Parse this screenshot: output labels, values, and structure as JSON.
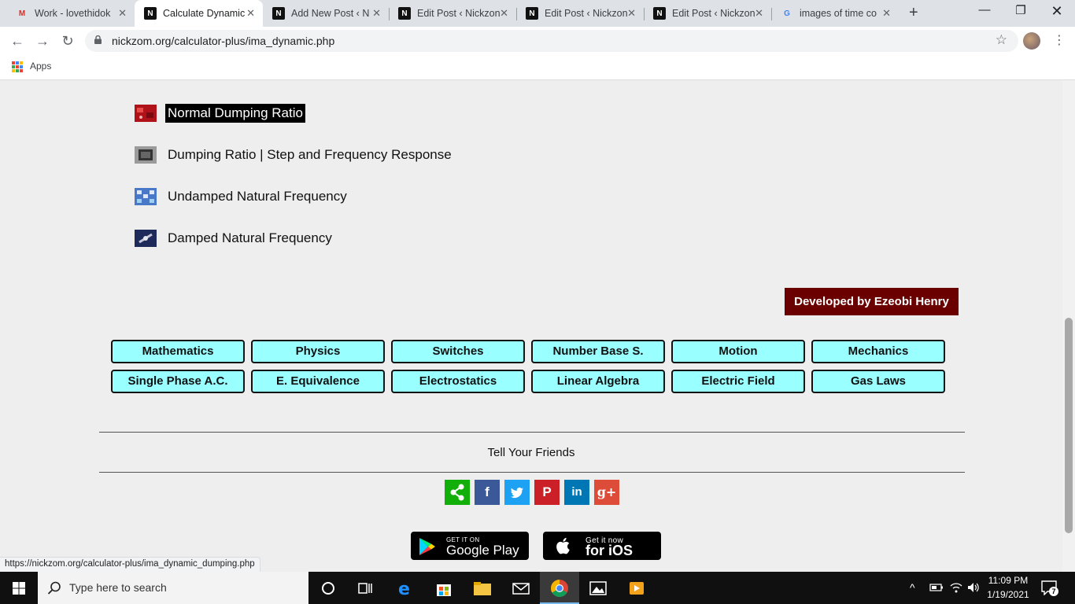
{
  "browser": {
    "tabs": [
      {
        "title": "Work - lovethidok",
        "favicon": "gmail-icon"
      },
      {
        "title": "Calculate Dynamic",
        "favicon": "nickzom-icon"
      },
      {
        "title": "Add New Post ‹ N",
        "favicon": "nickzom-icon"
      },
      {
        "title": "Edit Post ‹ Nickzon",
        "favicon": "nickzom-icon"
      },
      {
        "title": "Edit Post ‹ Nickzon",
        "favicon": "nickzom-icon"
      },
      {
        "title": "Edit Post ‹ Nickzon",
        "favicon": "nickzom-icon"
      },
      {
        "title": "images of time co",
        "favicon": "google-icon"
      }
    ],
    "url": "nickzom.org/calculator-plus/ima_dynamic.php",
    "bookmarks": {
      "apps_label": "Apps"
    },
    "status_url": "https://nickzom.org/calculator-plus/ima_dynamic_dumping.php"
  },
  "page": {
    "links": [
      {
        "label": "Normal Dumping Ratio",
        "icon": "circuit-board-thumbnail"
      },
      {
        "label": "Dumping Ratio | Step and Frequency Response",
        "icon": "chip-thumbnail"
      },
      {
        "label": "Undamped Natural Frequency",
        "icon": "network-thumbnail"
      },
      {
        "label": "Damped Natural Frequency",
        "icon": "satellite-thumbnail"
      }
    ],
    "developer_badge": "Developed by Ezeobi Henry",
    "categories": [
      [
        "Mathematics",
        "Physics",
        "Switches",
        "Number Base S.",
        "Motion",
        "Mechanics"
      ],
      [
        "Single Phase A.C.",
        "E. Equivalence",
        "Electrostatics",
        "Linear Algebra",
        "Electric Field",
        "Gas Laws"
      ]
    ],
    "tell_friends": "Tell Your Friends",
    "social": [
      {
        "name": "share",
        "color": "#12af0a",
        "glyph": "<"
      },
      {
        "name": "facebook",
        "color": "#3b5998",
        "glyph": "f"
      },
      {
        "name": "twitter",
        "color": "#1da1f2",
        "glyph": "t"
      },
      {
        "name": "pinterest",
        "color": "#cb2027",
        "glyph": "P"
      },
      {
        "name": "linkedin",
        "color": "#0077b5",
        "glyph": "in"
      },
      {
        "name": "google-plus",
        "color": "#dd4b39",
        "glyph": "g+"
      }
    ],
    "stores": {
      "google": {
        "small": "GET IT ON",
        "big": "Google Play"
      },
      "ios": {
        "small": "Get it now",
        "big": "for iOS"
      }
    }
  },
  "taskbar": {
    "search_placeholder": "Type here to search",
    "time": "11:09 PM",
    "date": "1/19/2021",
    "notifications": "7"
  }
}
